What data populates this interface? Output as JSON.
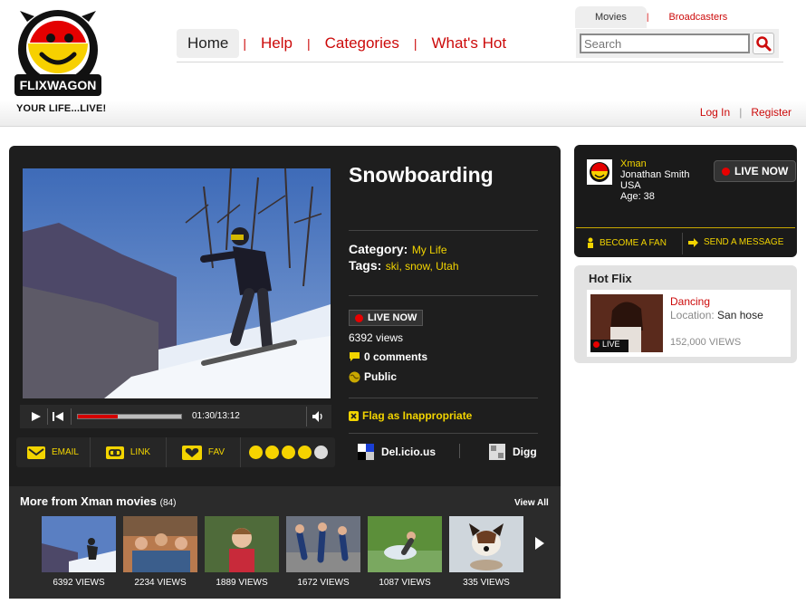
{
  "brand": {
    "name": "FLIXWAGON",
    "tagline": "YOUR LIFE...LIVE!"
  },
  "nav": {
    "items": [
      "Home",
      "Help",
      "Categories",
      "What's Hot"
    ]
  },
  "search": {
    "tabs": [
      "Movies",
      "Broadcasters"
    ],
    "placeholder": "Search"
  },
  "auth": {
    "login": "Log In",
    "register": "Register"
  },
  "video": {
    "title": "Snowboarding",
    "time": "01:30/13:12",
    "progress_fraction": 0.39,
    "category_label": "Category:",
    "category": "My Life",
    "tags_label": "Tags:",
    "tags": [
      "ski",
      "snow",
      "Utah"
    ],
    "live_label": "LIVE NOW",
    "views": "6392 views",
    "comments": "0 comments",
    "visibility": "Public",
    "flag": "Flag as Inappropriate",
    "delicious": "Del.icio.us",
    "digg": "Digg"
  },
  "share": {
    "email": "EMAIL",
    "link": "LINK",
    "fav": "FAV",
    "rating": 4
  },
  "more": {
    "title": "More from Xman movies",
    "count": "(84)",
    "view_all": "View All",
    "thumbs": [
      {
        "views": "6392 VIEWS"
      },
      {
        "views": "2234 VIEWS"
      },
      {
        "views": "1889 VIEWS"
      },
      {
        "views": "1672 VIEWS"
      },
      {
        "views": "1087 VIEWS"
      },
      {
        "views": "335 VIEWS"
      }
    ]
  },
  "profile": {
    "username": "Xman",
    "name": "Jonathan Smith",
    "country": "USA",
    "age": "Age: 38",
    "live_label": "LIVE NOW",
    "become_fan": "BECOME A FAN",
    "send_message": "SEND A MESSAGE"
  },
  "hotflix": {
    "title": "Hot Flix",
    "item_title": "Dancing",
    "location_label": "Location:",
    "location": "San hose",
    "views": "152,000 VIEWS",
    "live_label": "LIVE"
  },
  "colors": {
    "accent_red": "#cc0a0a",
    "accent_yellow": "#f2d400",
    "panel": "#1e1e1e"
  }
}
